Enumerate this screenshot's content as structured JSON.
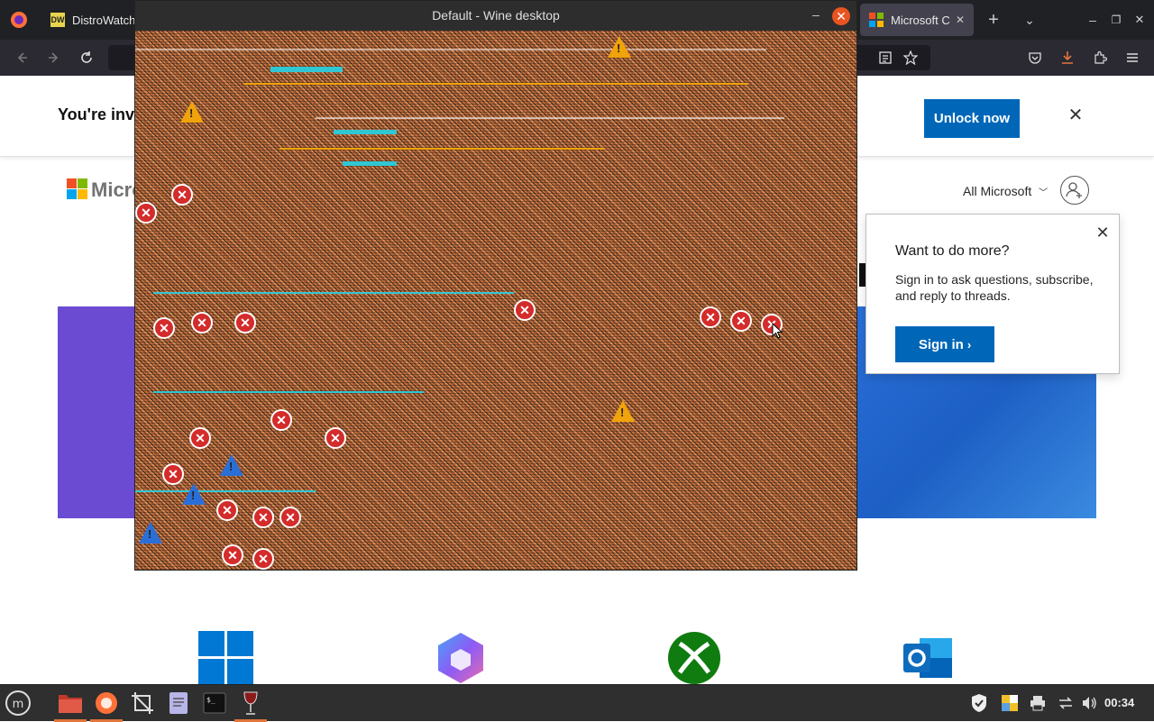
{
  "browser": {
    "tabs": [
      {
        "label": "DistroWatch",
        "active": false
      },
      {
        "label": "Microsoft C",
        "active": true
      }
    ],
    "new_tab_glyph": "+",
    "tab_list_glyph": "⌄",
    "window_controls": {
      "minimize": "–",
      "maximize": "❐",
      "close": "✕"
    }
  },
  "page": {
    "banner_text": "You're inv",
    "unlock_button": "Unlock now",
    "banner_close": "✕",
    "brand_name": "Micro",
    "all_microsoft": "All Microsoft",
    "popup": {
      "title": "Want to do more?",
      "body": "Sign in to ask questions, subscribe, and reply to threads.",
      "button": "Sign in",
      "close": "✕"
    },
    "product_icons": [
      "windows-icon",
      "copilot-icon",
      "xbox-icon",
      "outlook-icon"
    ]
  },
  "wine_window": {
    "title": "Default - Wine desktop",
    "minimize": "–",
    "close": "✕"
  },
  "taskbar": {
    "clock": "00:34"
  },
  "colors": {
    "ms_blue": "#0067b8",
    "firefox_dark": "#202124",
    "ubuntu_orange": "#e95420",
    "error_red": "#d42b2b",
    "warning_yellow": "#f0a30a"
  }
}
